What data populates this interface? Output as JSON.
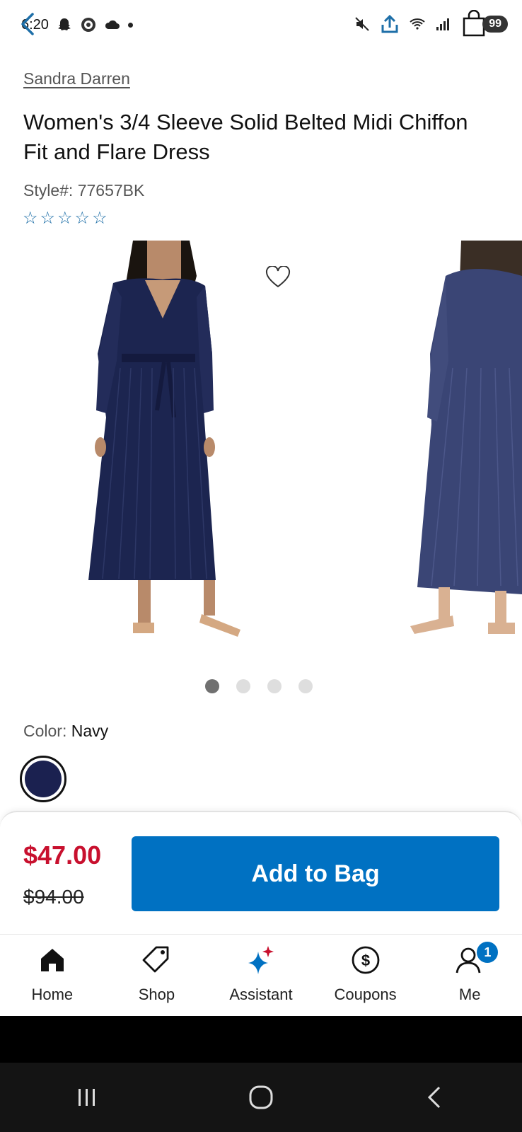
{
  "status_bar": {
    "time": "6:20",
    "signal": "5",
    "bag_badge": "99"
  },
  "product": {
    "brand": "Sandra Darren",
    "title": "Women's 3/4 Sleeve Solid Belted Midi Chiffon Fit and Flare Dress",
    "style_number": "Style#: 77657BK",
    "rating_stars": 0,
    "carousel": {
      "slides": 4,
      "active_index": 0
    },
    "color_label": "Color:",
    "color_value": "Navy",
    "swatch_color": "#1b2150"
  },
  "purchase": {
    "sale_price": "$47.00",
    "original_price": "$94.00",
    "add_button": "Add to Bag"
  },
  "tabbar": {
    "items": [
      {
        "label": "Home",
        "icon": "home-icon"
      },
      {
        "label": "Shop",
        "icon": "tag-icon"
      },
      {
        "label": "Assistant",
        "icon": "sparkle-icon"
      },
      {
        "label": "Coupons",
        "icon": "dollar-circle-icon"
      },
      {
        "label": "Me",
        "icon": "person-icon",
        "badge": "1"
      }
    ]
  },
  "colors": {
    "accent": "#0071c2",
    "sale_red": "#c8102e",
    "star_blue": "#1e6fa8"
  }
}
